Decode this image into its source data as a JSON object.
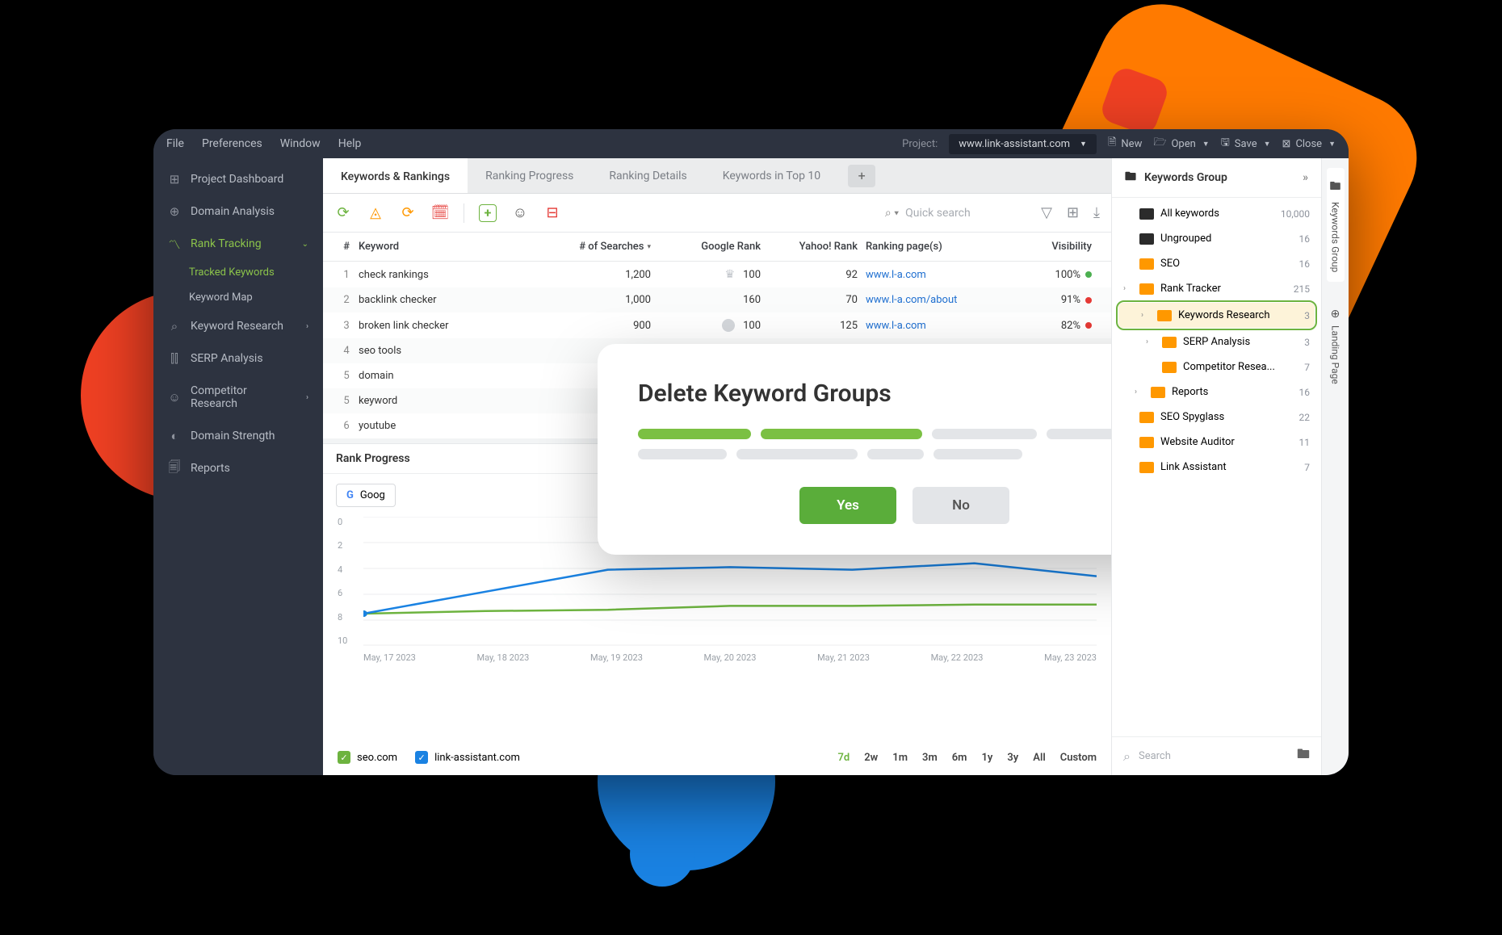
{
  "menubar": {
    "items": [
      "File",
      "Preferences",
      "Window",
      "Help"
    ],
    "project_label": "Project:",
    "project_value": "www.link-assistant.com",
    "actions": {
      "new": "New",
      "open": "Open",
      "save": "Save",
      "close": "Close"
    }
  },
  "sidebar": {
    "items": [
      {
        "label": "Project Dashboard"
      },
      {
        "label": "Domain Analysis"
      },
      {
        "label": "Rank Tracking",
        "active": true,
        "expanded": true
      },
      {
        "label": "Keyword Research",
        "chev": true
      },
      {
        "label": "SERP Analysis"
      },
      {
        "label": "Competitor Research",
        "chev": true
      },
      {
        "label": "Domain Strength"
      },
      {
        "label": "Reports"
      }
    ],
    "subs": [
      {
        "label": "Tracked Keywords",
        "active": true
      },
      {
        "label": "Keyword Map"
      }
    ]
  },
  "tabs": {
    "items": [
      "Keywords & Rankings",
      "Ranking Progress",
      "Ranking Details",
      "Keywords in Top 10"
    ],
    "active": 0
  },
  "search": {
    "placeholder": "Quick search"
  },
  "table": {
    "headers": {
      "num": "#",
      "keyword": "Keyword",
      "searches": "# of Searches",
      "grank": "Google Rank",
      "yrank": "Yahoo! Rank",
      "pages": "Ranking page(s)",
      "visibility": "Visibility"
    },
    "rows": [
      {
        "n": "1",
        "kw": "check rankings",
        "srch": "1,200",
        "grank": "100",
        "crown": true,
        "yrank": "92",
        "page": "www.l-a.com",
        "vis": "100%",
        "dot": "green"
      },
      {
        "n": "2",
        "kw": "backlink checker",
        "srch": "1,000",
        "grank": "160",
        "yrank": "70",
        "page": "www.l-a.com/about",
        "vis": "91%",
        "dot": "red"
      },
      {
        "n": "3",
        "kw": "broken link checker",
        "srch": "900",
        "grank": "100",
        "badge": true,
        "yrank": "125",
        "page": "www.l-a.com",
        "vis": "82%",
        "dot": "red"
      },
      {
        "n": "4",
        "kw": "seo tools"
      },
      {
        "n": "5",
        "kw": "domain "
      },
      {
        "n": "5",
        "kw": "keyword"
      },
      {
        "n": "6",
        "kw": "youtube"
      }
    ]
  },
  "chart": {
    "title": "Rank Progress",
    "se_select": "Goog",
    "legend": [
      {
        "label": "seo.com",
        "color": "green"
      },
      {
        "label": "link-assistant.com",
        "color": "blue"
      }
    ],
    "timerange": [
      "7d",
      "2w",
      "1m",
      "3m",
      "6m",
      "1y",
      "3y",
      "All",
      "Custom"
    ],
    "timerange_active": 0
  },
  "chart_data": {
    "type": "line",
    "title": "Rank Progress",
    "xlabel": "",
    "ylabel": "",
    "ylim": [
      0,
      10
    ],
    "y_ticks": [
      0,
      2,
      4,
      6,
      8,
      10
    ],
    "categories": [
      "May, 17 2023",
      "May, 18 2023",
      "May, 19 2023",
      "May, 20 2023",
      "May, 21 2023",
      "May, 22 2023",
      "May, 23 2023"
    ],
    "series": [
      {
        "name": "seo.com",
        "color": "#6db33f",
        "values": [
          7.5,
          7.3,
          7.2,
          6.9,
          6.9,
          6.8,
          6.8
        ]
      },
      {
        "name": "link-assistant.com",
        "color": "#1a82e2",
        "values": [
          7.5,
          5.8,
          4.1,
          3.9,
          4.1,
          3.6,
          4.6
        ]
      }
    ]
  },
  "right_panel": {
    "title": "Keywords Group",
    "folders": [
      {
        "label": "All keywords",
        "count": "10,000",
        "color": "black"
      },
      {
        "label": "Ungrouped",
        "count": "16",
        "color": "black"
      },
      {
        "label": "SEO",
        "count": "16",
        "color": "orange"
      },
      {
        "label": "Rank Tracker",
        "count": "215",
        "color": "orange",
        "chev": true
      },
      {
        "label": "Keywords Research",
        "count": "3",
        "color": "orange",
        "chev": true,
        "highlighted": true,
        "indent": 1
      },
      {
        "label": "SERP Analysis",
        "count": "3",
        "color": "orange",
        "chev": true,
        "indent": 2
      },
      {
        "label": "Competitor Resea...",
        "count": "7",
        "color": "orange",
        "indent": 2
      },
      {
        "label": "Reports",
        "count": "16",
        "color": "orange",
        "chev": true,
        "indent": 1
      },
      {
        "label": "SEO Spyglass",
        "count": "22",
        "color": "orange"
      },
      {
        "label": "Website Auditor",
        "count": "11",
        "color": "orange"
      },
      {
        "label": "Link Assistant",
        "count": "7",
        "color": "orange"
      }
    ],
    "search_placeholder": "Search"
  },
  "vtabs": {
    "items": [
      "Keywords Group",
      "Landing Page"
    ]
  },
  "modal": {
    "title": "Delete Keyword Groups",
    "yes": "Yes",
    "no": "No"
  }
}
